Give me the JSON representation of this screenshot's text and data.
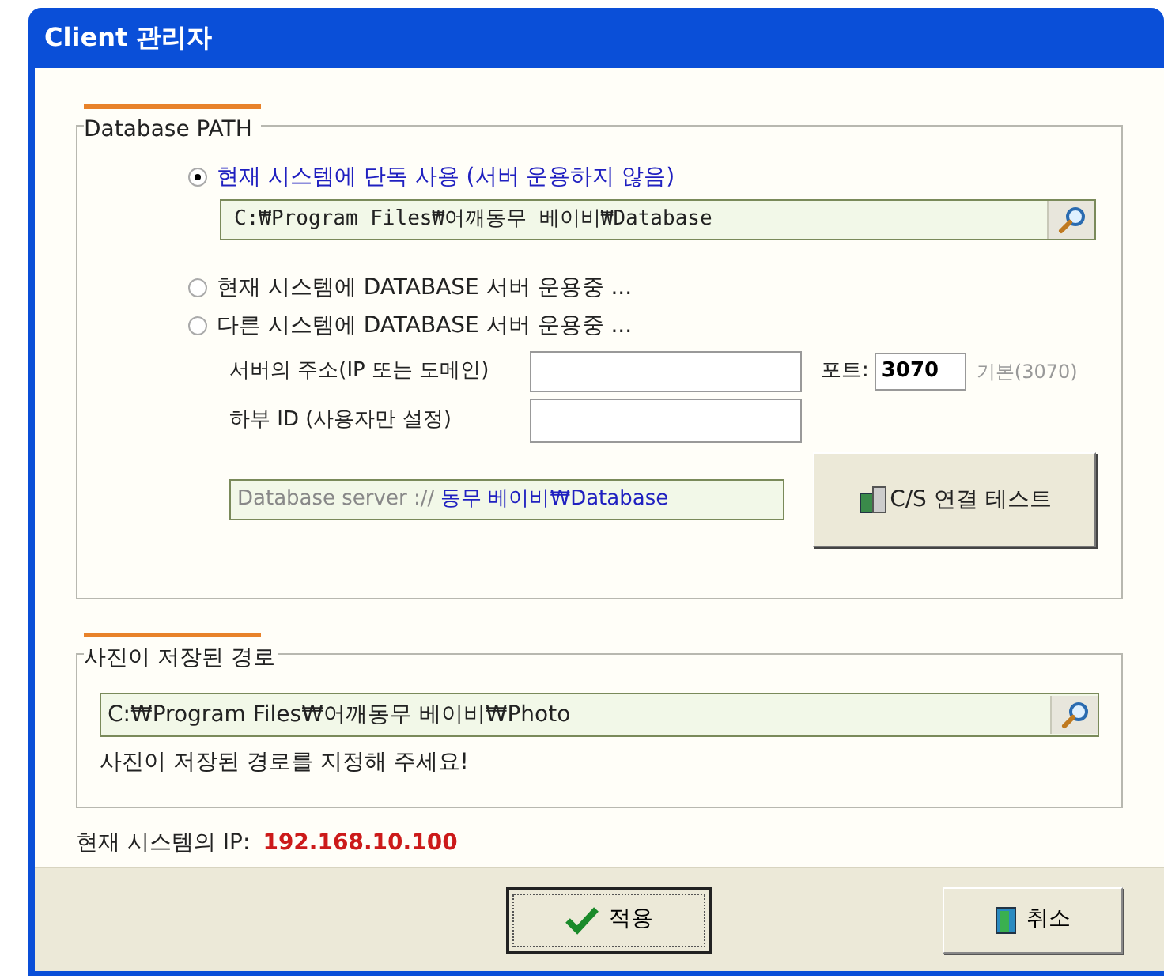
{
  "window": {
    "title": "Client 관리자"
  },
  "database_group": {
    "title": "Database PATH",
    "options": [
      {
        "label": "현재 시스템에 단독 사용 (서버 운용하지 않음)",
        "selected": true
      },
      {
        "label": "현재 시스템에 DATABASE 서버 운용중 ...",
        "selected": false
      },
      {
        "label": "다른 시스템에 DATABASE 서버 운용중 ...",
        "selected": false
      }
    ],
    "path": "C:₩Program Files₩어깨동무 베이비₩Database",
    "server_address_label": "서버의 주소(IP 또는 도메인)",
    "port_label": "포트:",
    "port": "3070",
    "port_default": "기본(3070)",
    "sub_id_label": "하부 ID (사용자만 설정)",
    "server_url_prefix": "Database server ://",
    "server_url": "동무 베이비₩Database",
    "test_button": "C/S 연결 테스트"
  },
  "photo_group": {
    "title": "사진이 저장된 경로",
    "path": "C:₩Program Files₩어깨동무 베이비₩Photo",
    "hint": "사진이 저장된 경로를 지정해 주세요!"
  },
  "ip": {
    "label": "현재 시스템의 IP:",
    "value": "192.168.10.100"
  },
  "buttons": {
    "apply": "적용",
    "cancel": "취소"
  }
}
